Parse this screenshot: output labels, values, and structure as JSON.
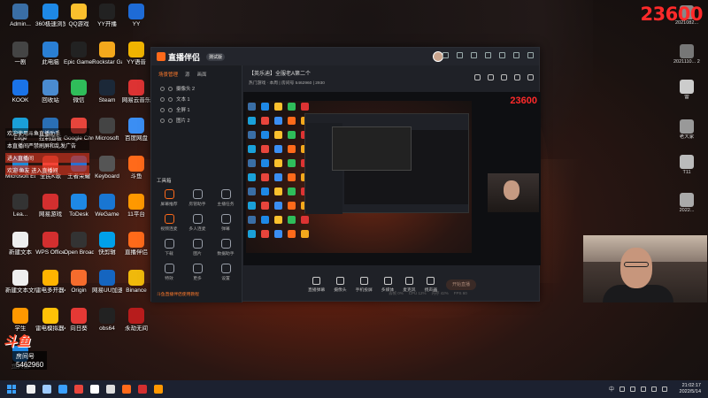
{
  "desktop_icons_left": [
    {
      "label": "Admin...",
      "color": "#3a6ea5"
    },
    {
      "label": "360极速浏览器",
      "color": "#1e88e5"
    },
    {
      "label": "QQ游戏",
      "color": "#fbc02d"
    },
    {
      "label": "YY开播",
      "color": "#222"
    },
    {
      "label": "YY",
      "color": "#1e6bd6"
    },
    {
      "label": "一剧",
      "color": "#444"
    },
    {
      "label": "此电脑",
      "color": "#2a7fd4"
    },
    {
      "label": "Epic Games Launcher",
      "color": "#222"
    },
    {
      "label": "Rockstar Games...",
      "color": "#f4a81c"
    },
    {
      "label": "YY语音",
      "color": "#f0b400"
    },
    {
      "label": "KOOK",
      "color": "#1a73e8"
    },
    {
      "label": "回收站",
      "color": "#4a8bd0"
    },
    {
      "label": "微信",
      "color": "#2fbd5a"
    },
    {
      "label": "Steam",
      "color": "#1b2838"
    },
    {
      "label": "网易云音乐",
      "color": "#d33"
    },
    {
      "label": "Edge",
      "color": "#1aa0d8"
    },
    {
      "label": "控制面板",
      "color": "#2a6fb5"
    },
    {
      "label": "Google Chrome",
      "color": "#e8453c"
    },
    {
      "label": "Microsoft",
      "color": "#444"
    },
    {
      "label": "百度网盘",
      "color": "#3b8ef3"
    },
    {
      "label": "Microsoft Edge",
      "color": "#1a8ad8"
    },
    {
      "label": "全民K歌",
      "color": "#f44336"
    },
    {
      "label": "王者荣耀",
      "color": "#2a6fd0"
    },
    {
      "label": "Keyboard",
      "color": "#555"
    },
    {
      "label": "斗鱼",
      "color": "#ff6a1a"
    },
    {
      "label": "Lea...",
      "color": "#333"
    },
    {
      "label": "网易游戏",
      "color": "#d32f2f"
    },
    {
      "label": "ToDesk",
      "color": "#1e88e5"
    },
    {
      "label": "WeGame",
      "color": "#1976d2"
    },
    {
      "label": "11平台",
      "color": "#ff9800"
    },
    {
      "label": "新建文本",
      "color": "#eee"
    },
    {
      "label": "WPS Office",
      "color": "#d32f2f"
    },
    {
      "label": "Open Broadcast...",
      "color": "#333"
    },
    {
      "label": "快剪辑",
      "color": "#00a0e9"
    },
    {
      "label": "直播伴侣",
      "color": "#ff6a1a"
    },
    {
      "label": "新建文本文档",
      "color": "#eee"
    },
    {
      "label": "雷电多开器4",
      "color": "#ffb300"
    },
    {
      "label": "Origin",
      "color": "#f56c2d"
    },
    {
      "label": "网易UU加速",
      "color": "#1565c0"
    },
    {
      "label": "Binance",
      "color": "#f0b90b"
    },
    {
      "label": "学生",
      "color": "#ff9800"
    },
    {
      "label": "雷电模拟器4",
      "color": "#ffc107"
    },
    {
      "label": "向日葵",
      "color": "#e53935"
    },
    {
      "label": "obs64",
      "color": "#222"
    },
    {
      "label": "永劫无间",
      "color": "#b71c1c"
    },
    {
      "label": "鱼大德",
      "color": "#1e88e5"
    }
  ],
  "desktop_icons_right": [
    {
      "label": "2021082...",
      "color": "#888"
    },
    {
      "label": "2021110... 2022011...",
      "color": "#777"
    },
    {
      "label": "雷",
      "color": "#ccc"
    },
    {
      "label": "老大家",
      "color": "#999"
    },
    {
      "label": "T11",
      "color": "#bbb"
    },
    {
      "label": "2022...",
      "color": "#aaa"
    }
  ],
  "counter": "23600",
  "chat": [
    {
      "text": "欢迎使用斗鱼直播助手",
      "highlight": false
    },
    {
      "text": "本直播间严禁刷屏和乱发广告",
      "highlight": false
    },
    {
      "text": "进入直播间",
      "highlight": true
    },
    {
      "text": "欢迎 鱼友 进入直播间",
      "highlight": true
    }
  ],
  "app": {
    "logo": "直播伴侣",
    "version": "测试版",
    "side_tabs": [
      "场景管理",
      "源",
      "画面"
    ],
    "scenes": [
      "摄像头 2",
      "文本 1",
      "全屏 1",
      "图片 2"
    ],
    "tools_title": "工具箱",
    "tools": [
      {
        "label": "屏幕推荐",
        "accent": true
      },
      {
        "label": "房管助手",
        "accent": false
      },
      {
        "label": "主播任务",
        "accent": false
      },
      {
        "label": "视频连麦",
        "accent": true
      },
      {
        "label": "多人连麦",
        "accent": false
      },
      {
        "label": "弹幕",
        "accent": false
      },
      {
        "label": "下载",
        "accent": false
      },
      {
        "label": "图片",
        "accent": false
      },
      {
        "label": "数据助手",
        "accent": false
      },
      {
        "label": "特效",
        "accent": false
      },
      {
        "label": "更多",
        "accent": false
      },
      {
        "label": "设置",
        "accent": false
      }
    ],
    "promo": "斗鱼直播伴侣使用教程",
    "room_title": "【英乐迪】全服老A第二个",
    "room_tags": "热门游戏 · 本周  |  房间号 5462960  |  2930",
    "preview_counter": "23600",
    "controls": [
      "直播弹幕",
      "摄像头",
      "手机投屏",
      "多媒体",
      "麦克风",
      "扬声器"
    ],
    "go_live": "开始直播",
    "stats": [
      "丢帧 0%",
      "CPU 12%",
      "内存 42%",
      "FPS 60"
    ]
  },
  "brand": {
    "name": "斗鱼",
    "room_label": "房间号",
    "room_id": "5462960"
  },
  "taskbar_apps": [
    {
      "color": "#eeeeee"
    },
    {
      "color": "#9ecbff"
    },
    {
      "color": "#3aa0ff"
    },
    {
      "color": "#e8453c"
    },
    {
      "color": "#ffffff"
    },
    {
      "color": "#dddddd"
    },
    {
      "color": "#ff6a1a"
    },
    {
      "color": "#d32f2f"
    },
    {
      "color": "#ff9800"
    }
  ],
  "tray": {
    "input": "中",
    "time": "21:02:17",
    "date": "2022/5/14"
  }
}
